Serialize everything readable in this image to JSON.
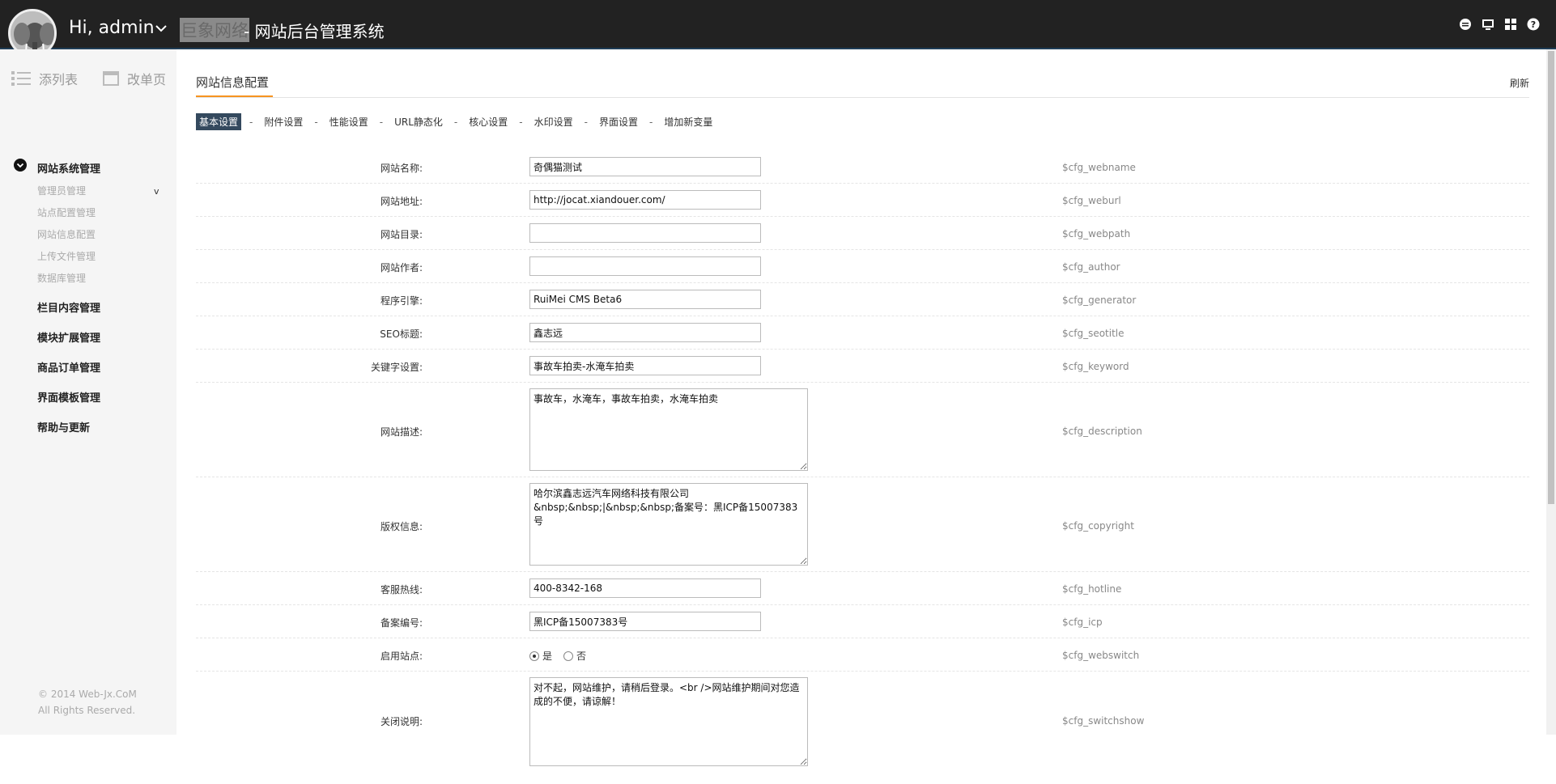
{
  "header": {
    "greeting": "Hi, admin",
    "title_highlight": "巨象网络",
    "title_rest": "- 网站后台管理系统"
  },
  "sidebar": {
    "tool_add_list": "添列表",
    "tool_edit_page": "改单页",
    "groups": [
      {
        "label": "网站系统管理",
        "items": [
          "管理员管理",
          "站点配置管理",
          "网站信息配置",
          "上传文件管理",
          "数据库管理"
        ]
      },
      {
        "label": "栏目内容管理"
      },
      {
        "label": "模块扩展管理"
      },
      {
        "label": "商品订单管理"
      },
      {
        "label": "界面模板管理"
      },
      {
        "label": "帮助与更新"
      }
    ],
    "sub_arrow": "v",
    "copyright_line1": "© 2014 Web-Jx.CoM",
    "copyright_line2": "All Rights Reserved."
  },
  "main": {
    "page_title": "网站信息配置",
    "refresh": "刷新",
    "tabs": [
      "基本设置",
      "附件设置",
      "性能设置",
      "URL静态化",
      "核心设置",
      "水印设置",
      "界面设置",
      "增加新变量"
    ],
    "tab_sep": "-",
    "rows": [
      {
        "label": "网站名称:",
        "value": "奇偶猫测试",
        "var": "$cfg_webname"
      },
      {
        "label": "网站地址:",
        "value": "http://jocat.xiandouer.com/",
        "var": "$cfg_weburl"
      },
      {
        "label": "网站目录:",
        "value": "",
        "var": "$cfg_webpath"
      },
      {
        "label": "网站作者:",
        "value": "",
        "var": "$cfg_author"
      },
      {
        "label": "程序引擎:",
        "value": "RuiMei CMS Beta6",
        "var": "$cfg_generator"
      },
      {
        "label": "SEO标题:",
        "value": "鑫志远",
        "var": "$cfg_seotitle"
      },
      {
        "label": "关键字设置:",
        "value": "事故车拍卖-水淹车拍卖",
        "var": "$cfg_keyword"
      },
      {
        "label": "网站描述:",
        "value": "事故车，水淹车，事故车拍卖，水淹车拍卖",
        "var": "$cfg_description"
      },
      {
        "label": "版权信息:",
        "value": "哈尔滨鑫志远汽车网络科技有限公司\n&nbsp;&nbsp;|&nbsp;&nbsp;备案号：黑ICP备15007383号",
        "var": "$cfg_copyright"
      },
      {
        "label": "客服热线:",
        "value": "400-8342-168",
        "var": "$cfg_hotline"
      },
      {
        "label": "备案编号:",
        "value": "黑ICP备15007383号",
        "var": "$cfg_icp"
      },
      {
        "label": "启用站点:",
        "opt_yes": "是",
        "opt_no": "否",
        "selected": "是",
        "var": "$cfg_webswitch"
      },
      {
        "label": "关闭说明:",
        "value": "对不起，网站维护，请稍后登录。<br />网站维护期间对您造成的不便，请谅解！",
        "var": "$cfg_switchshow"
      }
    ]
  }
}
